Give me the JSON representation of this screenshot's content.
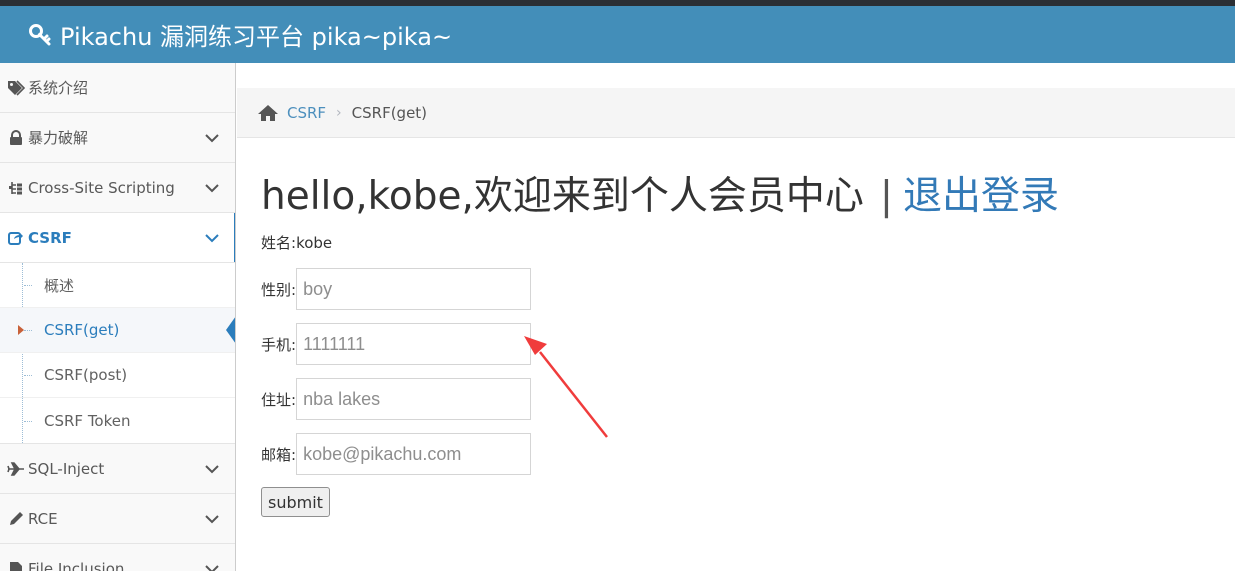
{
  "app": {
    "title": "Pikachu 漏洞练习平台 pika~pika~",
    "header_color": "#438eb9"
  },
  "sidebar": {
    "items": [
      {
        "label": "系统介绍",
        "icon": "tags-icon"
      },
      {
        "label": "暴力破解",
        "icon": "lock-icon"
      },
      {
        "label": "Cross-Site Scripting",
        "icon": "sitemap-icon"
      },
      {
        "label": "CSRF",
        "icon": "share-icon",
        "active": true
      },
      {
        "label": "SQL-Inject",
        "icon": "plane-icon"
      },
      {
        "label": "RCE",
        "icon": "pencil-icon"
      },
      {
        "label": "File Inclusion",
        "icon": "file-icon"
      }
    ],
    "csrf_sub": [
      {
        "label": "概述"
      },
      {
        "label": "CSRF(get)",
        "active": true
      },
      {
        "label": "CSRF(post)"
      },
      {
        "label": "CSRF Token"
      }
    ]
  },
  "breadcrumb": {
    "link": "CSRF",
    "current": "CSRF(get)"
  },
  "main": {
    "greeting": "hello,kobe,欢迎来到个人会员中心",
    "separator": "|",
    "logout": "退出登录",
    "name_label": "姓名:",
    "name_value": "kobe",
    "fields": [
      {
        "label": "性别:",
        "placeholder": "boy"
      },
      {
        "label": "手机:",
        "placeholder": "1111111"
      },
      {
        "label": "住址:",
        "placeholder": "nba lakes"
      },
      {
        "label": "邮箱:",
        "placeholder": "kobe@pikachu.com"
      }
    ],
    "submit": "submit"
  },
  "annotation": {
    "arrow_color": "#f03c3c"
  }
}
